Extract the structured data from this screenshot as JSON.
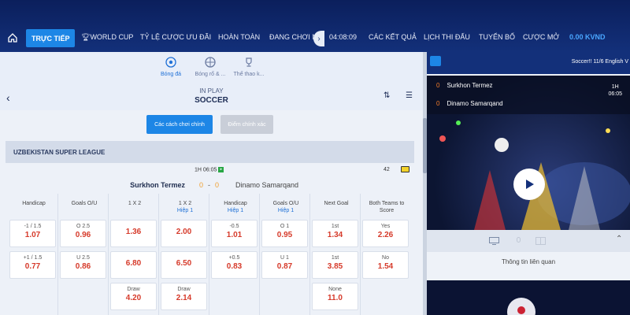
{
  "nav": {
    "live_label": "TRỰC TIẾP",
    "items": [
      "WORLD CUP",
      "TỶ LỆ CƯỢC ƯU ĐÃI",
      "HOÀN TOÀN",
      "ĐANG CHƠI N",
      "04:08:09",
      "CÁC KẾT QUẢ",
      "LỊCH THI ĐẤU",
      "TUYỂN BỐ",
      "CƯỢC MỞ",
      "0.00 KVND"
    ]
  },
  "sports": [
    {
      "label": "Bóng đá",
      "icon": "soccer-ball-icon"
    },
    {
      "label": "Bóng rổ & ...",
      "icon": "basketball-icon"
    },
    {
      "label": "Thể thao k...",
      "icon": "trophy-icon"
    }
  ],
  "header": {
    "in_play": "IN PLAY",
    "sport": "SOCCER"
  },
  "buttons": {
    "main_bets": "Các cách chơi chính",
    "exact_score": "Điểm chính xác"
  },
  "league": "UZBEKISTAN SUPER LEAGUE",
  "match": {
    "time": "1H 06:05",
    "count": "42",
    "home": "Surkhon Termez",
    "home_score": "0",
    "separator": "-",
    "away_score": "0",
    "away": "Dinamo Samarqand"
  },
  "columns": [
    {
      "title": "Handicap",
      "sub": "",
      "cells": [
        {
          "label": "-1 / 1.5",
          "odd": "1.07"
        },
        {
          "label": "+1 / 1.5",
          "odd": "0.77"
        }
      ]
    },
    {
      "title": "Goals O/U",
      "sub": "",
      "cells": [
        {
          "label": "O 2.5",
          "odd": "0.96"
        },
        {
          "label": "U 2.5",
          "odd": "0.86"
        }
      ]
    },
    {
      "title": "1 X 2",
      "sub": "",
      "cells": [
        {
          "label": "",
          "odd": "1.36"
        },
        {
          "label": "",
          "odd": "6.80"
        },
        {
          "label": "Draw",
          "odd": "4.20"
        }
      ]
    },
    {
      "title": "1 X 2",
      "sub": "Hiệp 1",
      "cells": [
        {
          "label": "",
          "odd": "2.00"
        },
        {
          "label": "",
          "odd": "6.50"
        },
        {
          "label": "Draw",
          "odd": "2.14"
        }
      ]
    },
    {
      "title": "Handicap",
      "sub": "Hiệp 1",
      "cells": [
        {
          "label": "-0.5",
          "odd": "1.01"
        },
        {
          "label": "+0.5",
          "odd": "0.83"
        }
      ]
    },
    {
      "title": "Goals O/U",
      "sub": "Hiệp 1",
      "cells": [
        {
          "label": "O 1",
          "odd": "0.95"
        },
        {
          "label": "U 1",
          "odd": "0.87"
        }
      ]
    },
    {
      "title": "Next Goal",
      "sub": "",
      "cells": [
        {
          "label": "1st",
          "odd": "1.34"
        },
        {
          "label": "1st",
          "odd": "3.85"
        },
        {
          "label": "None",
          "odd": "11.0"
        }
      ]
    },
    {
      "title": "Both Teams to Score",
      "sub": "",
      "cells": [
        {
          "label": "Yes",
          "odd": "2.26"
        },
        {
          "label": "No",
          "odd": "1.54"
        }
      ]
    }
  ],
  "right": {
    "panel_title": "Soccer!! 11/6 English V",
    "home": "Surkhon Termez",
    "away": "Dinamo Samarqand",
    "home_score": "0",
    "away_score": "0",
    "period": "1H",
    "clock": "06:05",
    "related": "Thông tin liên quan"
  },
  "colors": {
    "accent": "#1d86e6",
    "odds": "#d63a2a",
    "nav_bg": "#13307a"
  }
}
